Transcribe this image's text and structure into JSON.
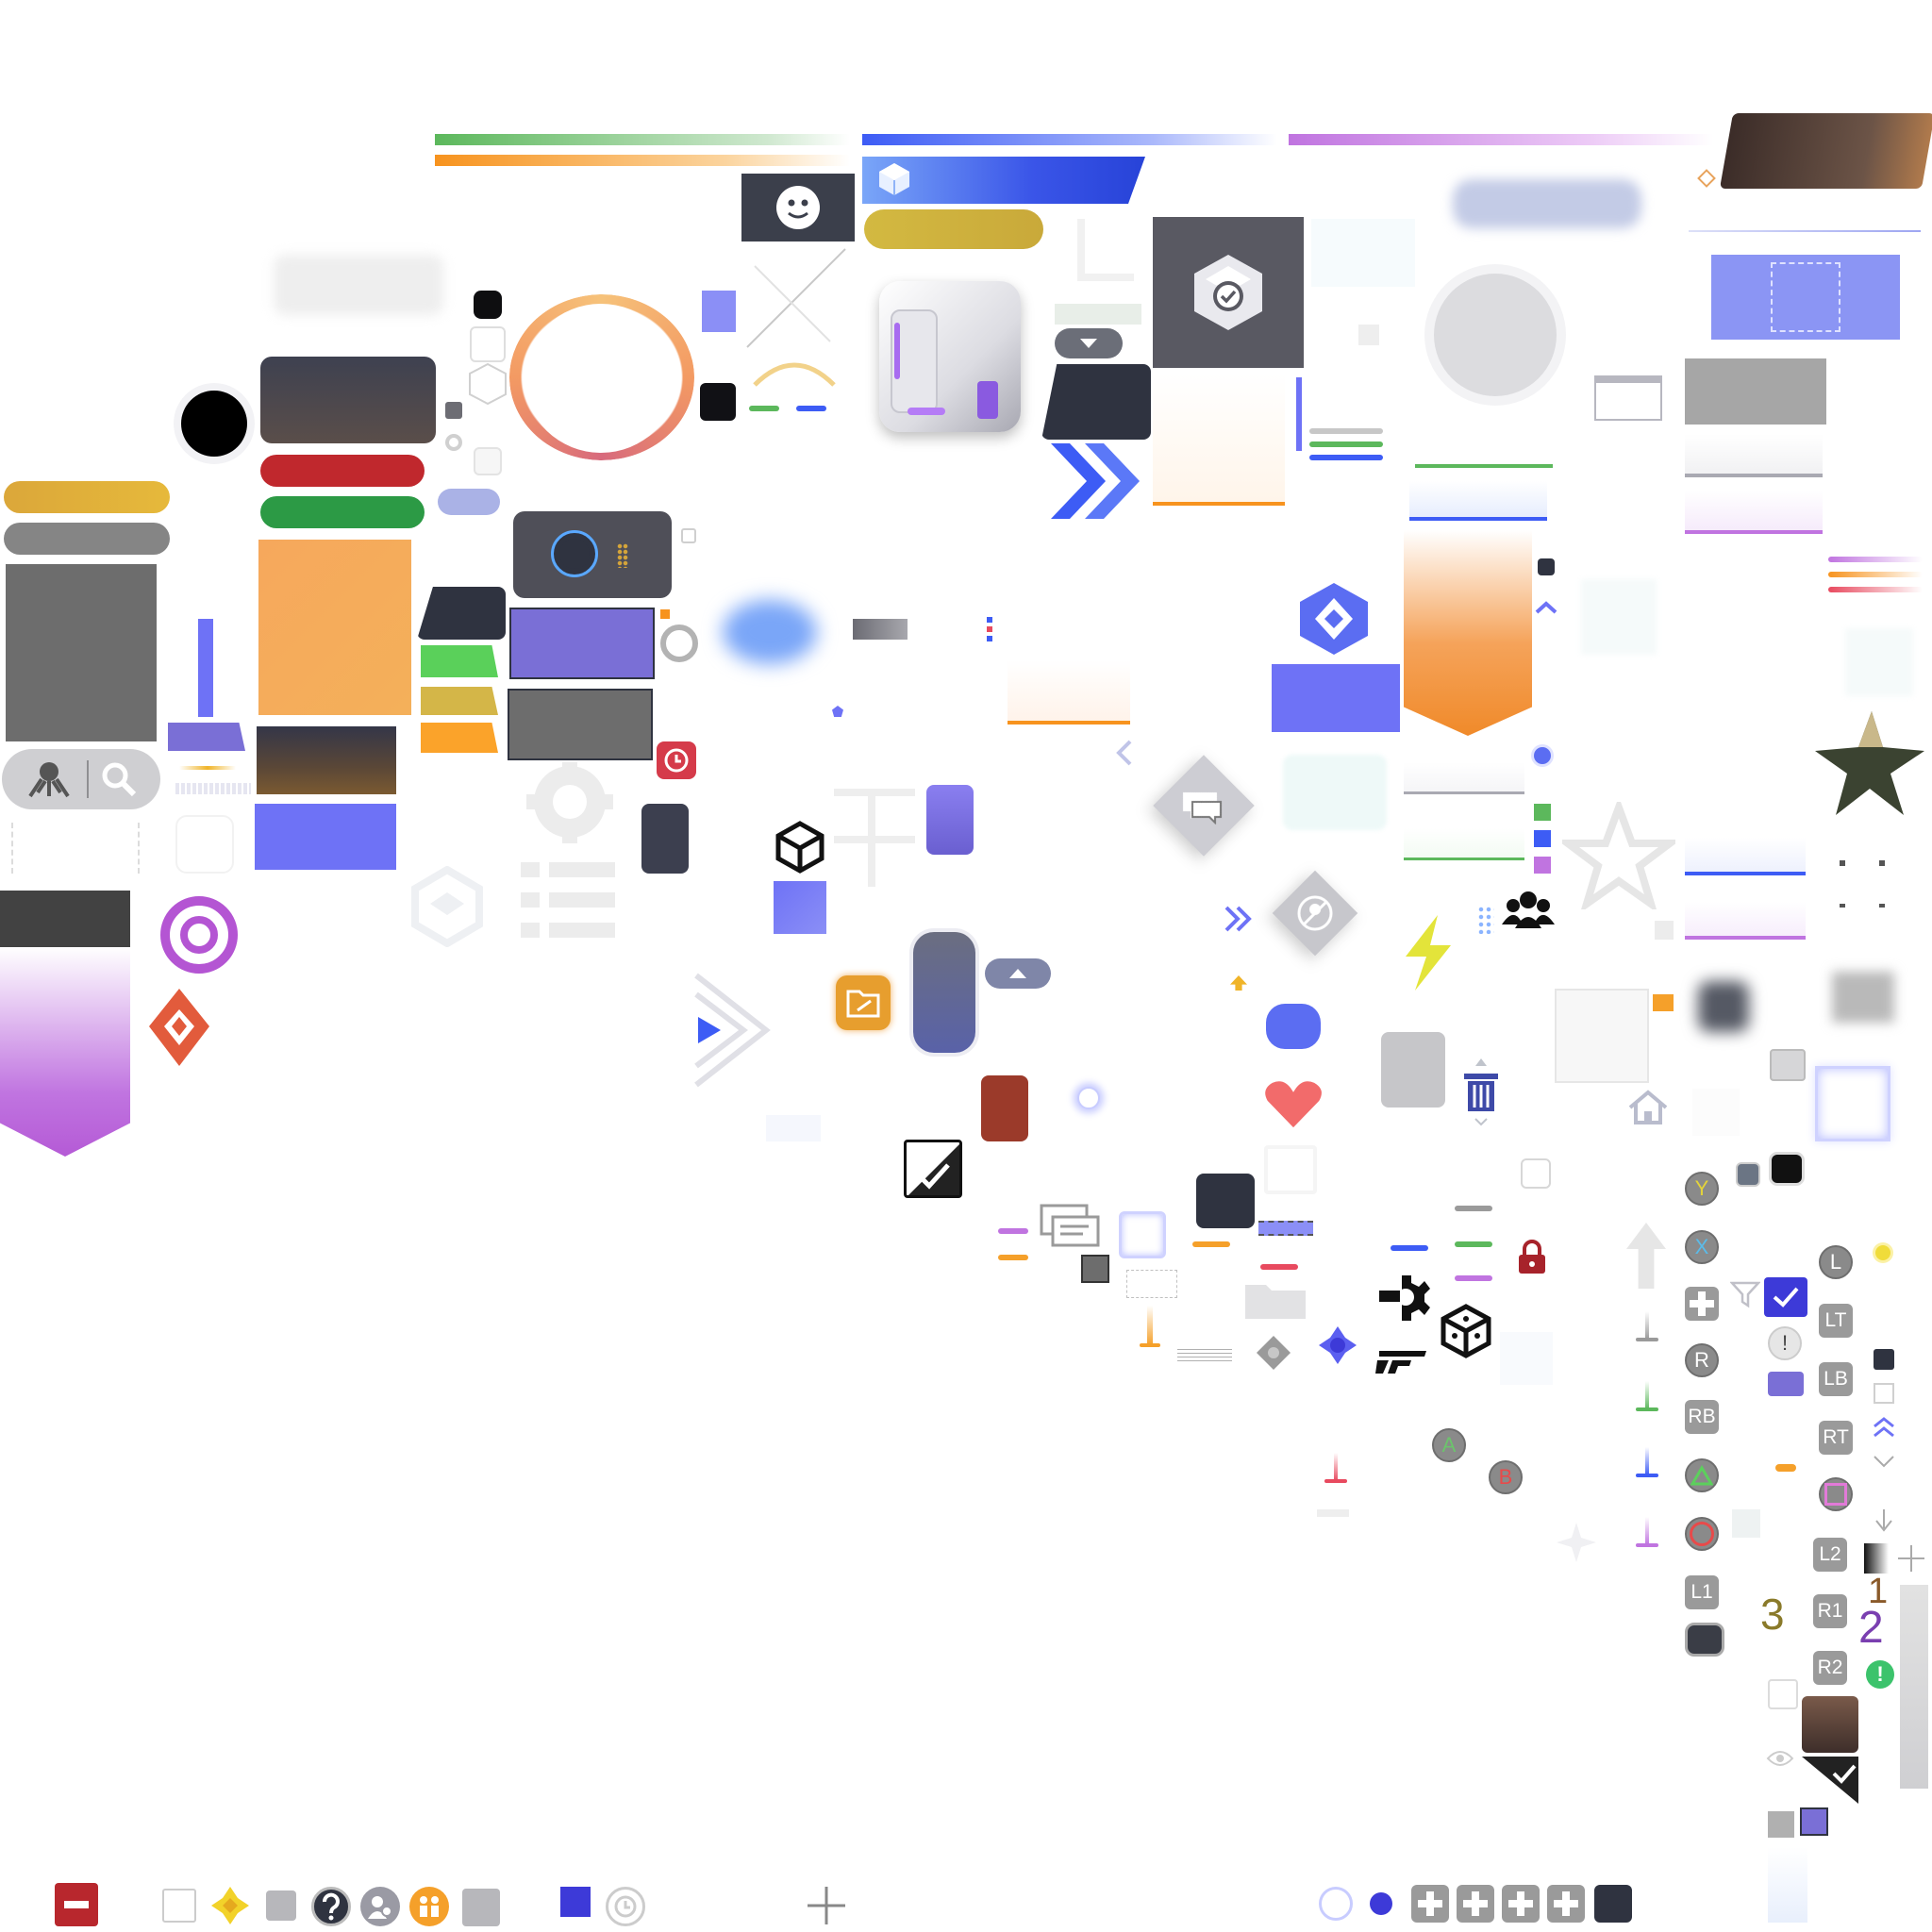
{
  "colors": {
    "green": "#5cb85c",
    "orange": "#f7931e",
    "blue": "#3d5cf5",
    "purple": "#c074e0",
    "gold": "#d7b33a",
    "violet": "#7a6fd6",
    "periwinkle": "#6e72f6",
    "red": "#c0282d",
    "dark": "#2f3340",
    "gray": "#6d6d6d"
  },
  "icons": [
    "smiley-icon",
    "cube-icon",
    "shield-check-icon",
    "gear-icon",
    "search-icon",
    "target-icon",
    "diamond-icon",
    "star-icon",
    "heart-icon",
    "trash-icon",
    "home-icon",
    "lock-icon",
    "chat-icon",
    "checkmark-icon",
    "chevron-double-right-icon",
    "users-icon",
    "lightning-icon",
    "filter-icon",
    "eye-icon",
    "clock-icon",
    "question-icon",
    "person-icon",
    "family-icon",
    "minus-icon",
    "plus-icon",
    "folder-icon",
    "dpad-icon"
  ],
  "gamepad": {
    "face_buttons": {
      "y": "Y",
      "x": "X",
      "r": "R",
      "l": "L",
      "a": "A",
      "b": "B"
    },
    "shoulder": {
      "lt": "LT",
      "lb": "LB",
      "rb": "RB",
      "rt": "RT",
      "l1": "L1",
      "l2": "L2",
      "r1": "R1",
      "r2": "R2"
    },
    "exclamation": "!"
  },
  "numbers": {
    "one": "1",
    "two": "2",
    "three": "3"
  }
}
